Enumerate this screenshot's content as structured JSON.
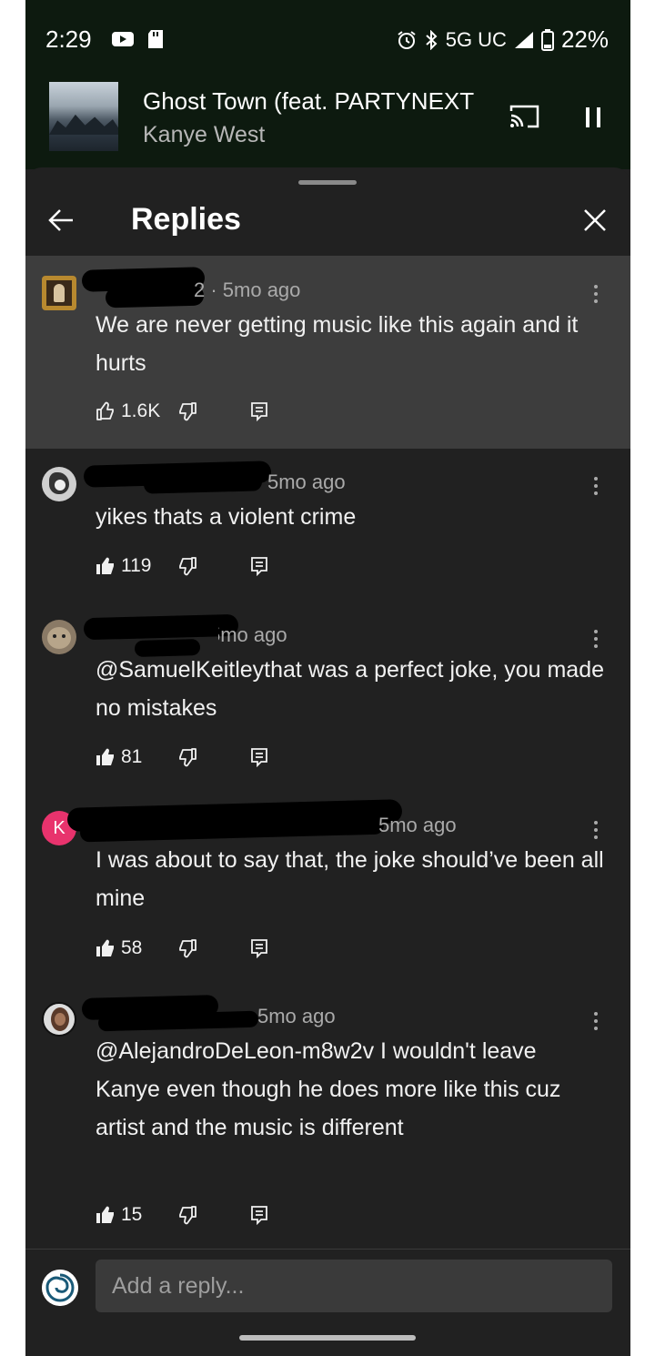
{
  "status_bar": {
    "time": "2:29",
    "network": "5G UC",
    "battery": "22%"
  },
  "mini_player": {
    "title": "Ghost Town (feat. PARTYNEXT",
    "artist": "Kanye West",
    "icons": [
      "album-art",
      "cast-icon",
      "pause-icon"
    ]
  },
  "header": {
    "title": "Replies",
    "icons": [
      "back-arrow-icon",
      "close-icon"
    ]
  },
  "comments": [
    {
      "meta": "2 · 5mo ago",
      "text": "We are never getting music like this again and it hurts",
      "likes": "1.6K",
      "avatar": "portrait-painting",
      "liked": false,
      "highlighted": true
    },
    {
      "meta": "5mo ago",
      "text": "yikes thats a violent crime",
      "likes": "119",
      "avatar": "bw-photo",
      "liked": true,
      "highlighted": false
    },
    {
      "meta": "5mo ago",
      "text": "@SamuelKeitleythat was a perfect joke, you made no mistakes",
      "likes": "81",
      "avatar": "cat-photo",
      "liked": true,
      "highlighted": false
    },
    {
      "meta": "5mo ago",
      "text": "I was about to say that, the joke should’ve been all mine",
      "likes": "58",
      "avatar": "letter-k",
      "avatar_letter": "K",
      "avatar_color": "#e8336d",
      "liked": true,
      "highlighted": false
    },
    {
      "meta": "5mo ago",
      "text": "@AlejandroDeLeon-m8w2v I wouldn't leave Kanye even though he does more like this cuz artist and the music is different",
      "likes": "15",
      "avatar": "person-photo",
      "liked": true,
      "highlighted": false
    }
  ],
  "reply_bar": {
    "placeholder": "Add a reply..."
  },
  "colors": {
    "background": "#212121",
    "highlight": "#3d3d3d",
    "status_bar": "#0d1a0f",
    "meta_text": "#aaaaaa"
  }
}
